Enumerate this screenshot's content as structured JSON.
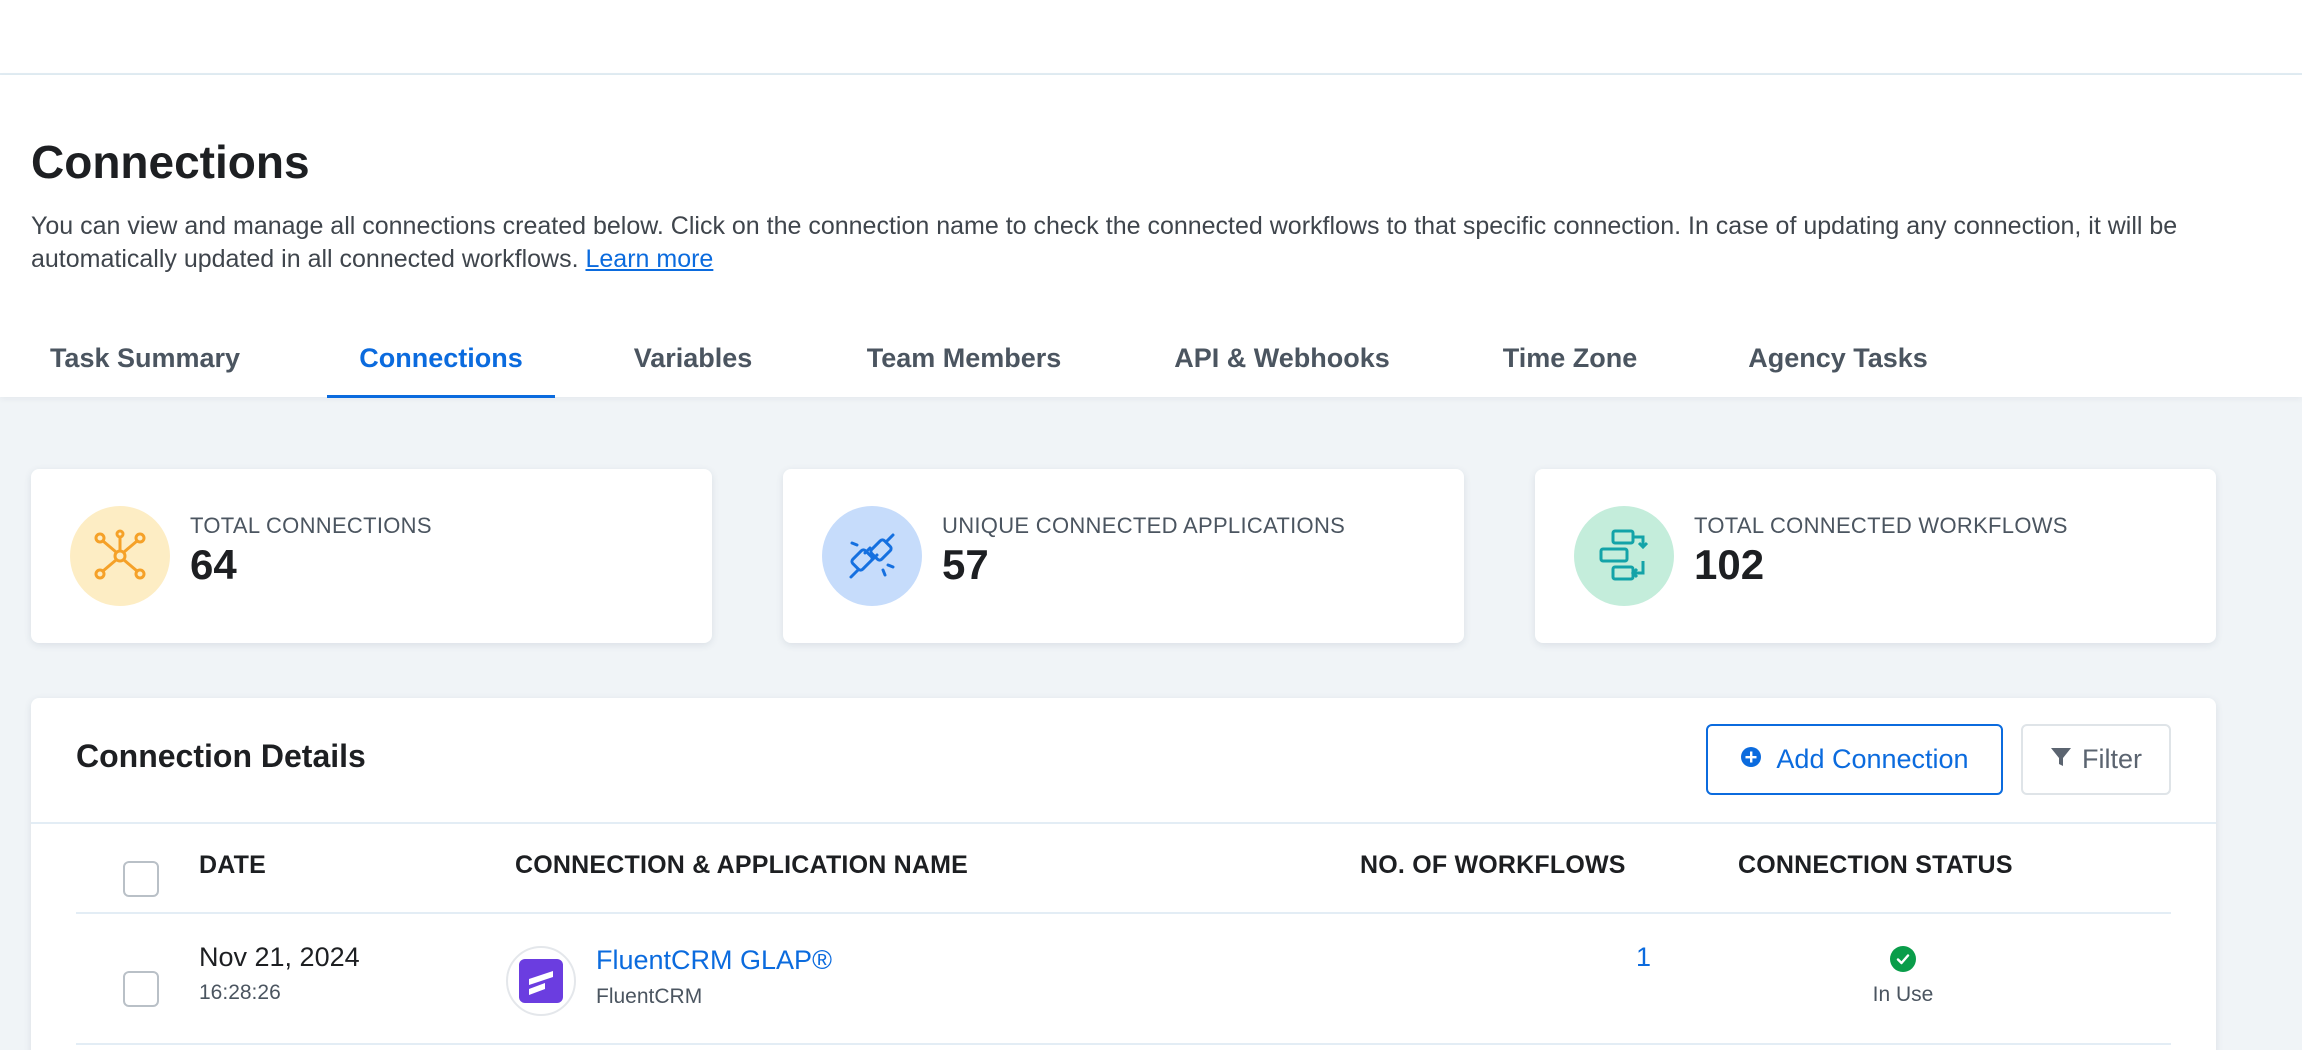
{
  "page": {
    "title": "Connections",
    "description": "You can view and manage all connections created below. Click on the connection name to check the connected workflows to that specific connection. In case of updating any connection, it will be automatically updated in all connected workflows.",
    "learn_more": "Learn more"
  },
  "tabs": [
    {
      "label": "Task Summary",
      "active": false
    },
    {
      "label": "Connections",
      "active": true
    },
    {
      "label": "Variables",
      "active": false
    },
    {
      "label": "Team Members",
      "active": false
    },
    {
      "label": "API & Webhooks",
      "active": false
    },
    {
      "label": "Time Zone",
      "active": false
    },
    {
      "label": "Agency Tasks",
      "active": false
    }
  ],
  "stats": [
    {
      "label": "TOTAL CONNECTIONS",
      "value": "64",
      "icon": "network-icon",
      "icon_bg": "#fdedc4",
      "icon_color": "#f5a128"
    },
    {
      "label": "UNIQUE CONNECTED APPLICATIONS",
      "value": "57",
      "icon": "plug-icon",
      "icon_bg": "#c6dcfb",
      "icon_color": "#1570e0"
    },
    {
      "label": "TOTAL CONNECTED WORKFLOWS",
      "value": "102",
      "icon": "workflow-icon",
      "icon_bg": "#c4eddb",
      "icon_color": "#13a3a8"
    }
  ],
  "details": {
    "title": "Connection Details",
    "add_button": "Add Connection",
    "filter_button": "Filter",
    "columns": {
      "date": "DATE",
      "name": "CONNECTION & APPLICATION NAME",
      "workflows": "NO. OF WORKFLOWS",
      "status": "CONNECTION STATUS"
    },
    "rows": [
      {
        "date": "Nov 21, 2024",
        "time": "16:28:26",
        "connection_name": "FluentCRM GLAP®",
        "app_name": "FluentCRM",
        "app_icon": "fluentcrm-logo",
        "workflows": "1",
        "status": "In Use"
      }
    ]
  },
  "colors": {
    "accent": "#0b6bde",
    "success": "#0a9d4a",
    "fluentcrm": "#6b3de0"
  }
}
